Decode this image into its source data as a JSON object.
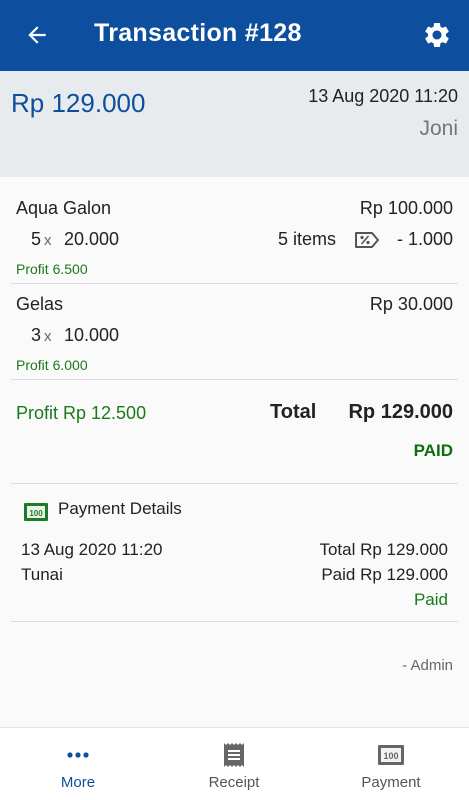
{
  "appbar": {
    "title": "Transaction #128",
    "back_icon": "arrow-left-icon",
    "settings_icon": "gear-icon"
  },
  "summary": {
    "amount": "Rp 129.000",
    "date": "13 Aug 2020 11:20",
    "user": "Joni"
  },
  "items": [
    {
      "name": "Aqua Galon",
      "total": "Rp 100.000",
      "qty": "5",
      "times": "x",
      "price": "20.000",
      "count_label": "5 items",
      "discount": "- 1.000",
      "profit": "Profit 6.500"
    },
    {
      "name": "Gelas",
      "total": "Rp 30.000",
      "qty": "3",
      "times": "x",
      "price": "10.000",
      "profit": "Profit 6.000"
    }
  ],
  "totals": {
    "profit": "Profit Rp 12.500",
    "total_label": "Total",
    "total_value": "Rp 129.000",
    "status": "PAID"
  },
  "payment": {
    "header": "Payment Details",
    "date": "13 Aug 2020 11:20",
    "method": "Tunai",
    "total_line": "Total Rp 129.000",
    "paid_line": "Paid Rp 129.000",
    "status": "Paid",
    "signature": "- Admin"
  },
  "bottom_nav": [
    {
      "label": "More",
      "icon": "more-dots-icon",
      "active": true
    },
    {
      "label": "Receipt",
      "icon": "receipt-icon",
      "active": false
    },
    {
      "label": "Payment",
      "icon": "payment-icon",
      "active": false
    }
  ],
  "colors": {
    "primary": "#0d4f9e",
    "profit_green": "#1b7a1b",
    "paid_green": "#0f6e0f"
  }
}
